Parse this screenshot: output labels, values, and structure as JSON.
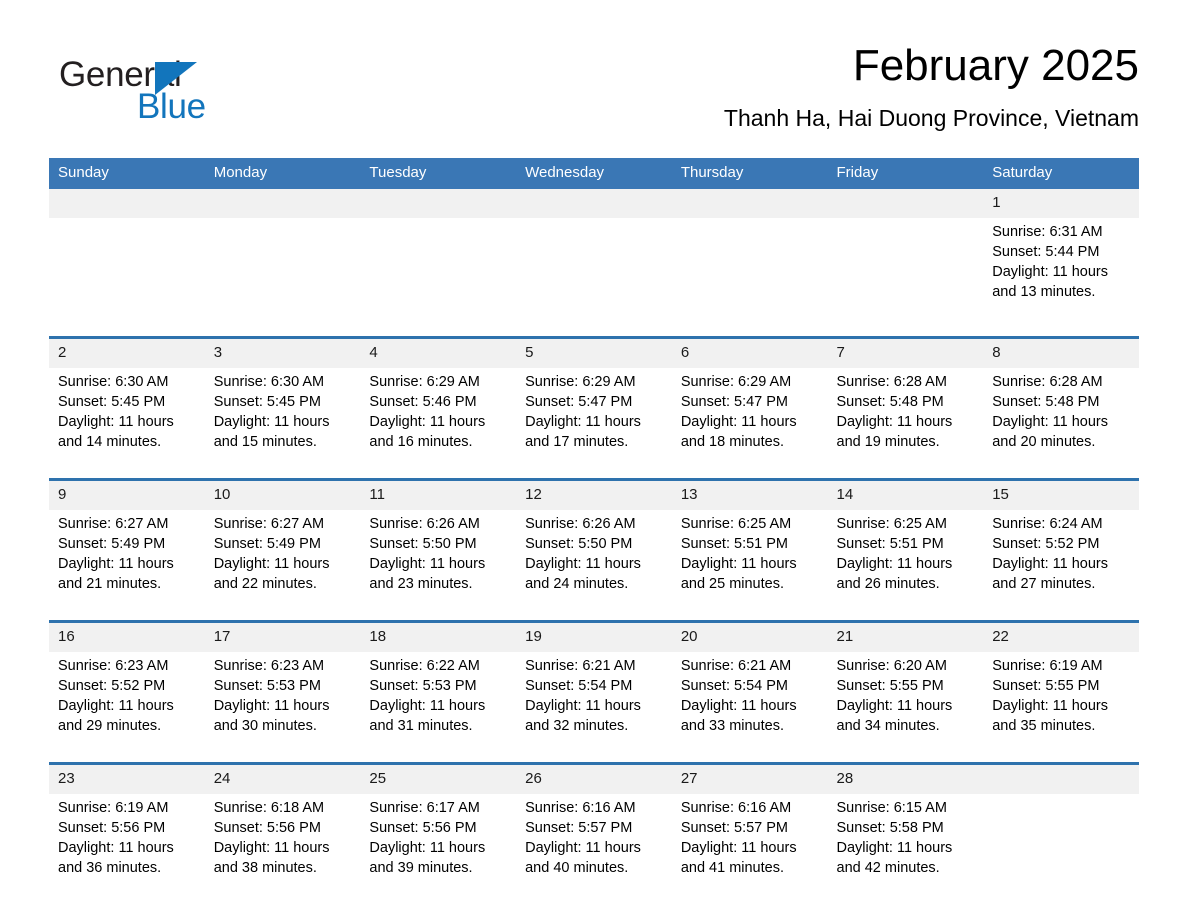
{
  "brand": {
    "name_part1": "General",
    "name_part2": "Blue",
    "accent_color": "#1275bc"
  },
  "header": {
    "month_title": "February 2025",
    "location": "Thanh Ha, Hai Duong Province, Vietnam",
    "header_bg_color": "#3a77b5",
    "week_separator_color": "#2e72ad",
    "daynum_bg_color": "#f1f1f1"
  },
  "weekdays": [
    "Sunday",
    "Monday",
    "Tuesday",
    "Wednesday",
    "Thursday",
    "Friday",
    "Saturday"
  ],
  "labels": {
    "sunrise_prefix": "Sunrise:",
    "sunset_prefix": "Sunset:",
    "daylight_prefix": "Daylight:"
  },
  "weeks": [
    {
      "days": [
        {
          "num": "",
          "sunrise": "",
          "sunset": "",
          "daylight_line1": "",
          "daylight_line2": ""
        },
        {
          "num": "",
          "sunrise": "",
          "sunset": "",
          "daylight_line1": "",
          "daylight_line2": ""
        },
        {
          "num": "",
          "sunrise": "",
          "sunset": "",
          "daylight_line1": "",
          "daylight_line2": ""
        },
        {
          "num": "",
          "sunrise": "",
          "sunset": "",
          "daylight_line1": "",
          "daylight_line2": ""
        },
        {
          "num": "",
          "sunrise": "",
          "sunset": "",
          "daylight_line1": "",
          "daylight_line2": ""
        },
        {
          "num": "",
          "sunrise": "",
          "sunset": "",
          "daylight_line1": "",
          "daylight_line2": ""
        },
        {
          "num": "1",
          "sunrise": "Sunrise: 6:31 AM",
          "sunset": "Sunset: 5:44 PM",
          "daylight_line1": "Daylight: 11 hours",
          "daylight_line2": "and 13 minutes."
        }
      ]
    },
    {
      "days": [
        {
          "num": "2",
          "sunrise": "Sunrise: 6:30 AM",
          "sunset": "Sunset: 5:45 PM",
          "daylight_line1": "Daylight: 11 hours",
          "daylight_line2": "and 14 minutes."
        },
        {
          "num": "3",
          "sunrise": "Sunrise: 6:30 AM",
          "sunset": "Sunset: 5:45 PM",
          "daylight_line1": "Daylight: 11 hours",
          "daylight_line2": "and 15 minutes."
        },
        {
          "num": "4",
          "sunrise": "Sunrise: 6:29 AM",
          "sunset": "Sunset: 5:46 PM",
          "daylight_line1": "Daylight: 11 hours",
          "daylight_line2": "and 16 minutes."
        },
        {
          "num": "5",
          "sunrise": "Sunrise: 6:29 AM",
          "sunset": "Sunset: 5:47 PM",
          "daylight_line1": "Daylight: 11 hours",
          "daylight_line2": "and 17 minutes."
        },
        {
          "num": "6",
          "sunrise": "Sunrise: 6:29 AM",
          "sunset": "Sunset: 5:47 PM",
          "daylight_line1": "Daylight: 11 hours",
          "daylight_line2": "and 18 minutes."
        },
        {
          "num": "7",
          "sunrise": "Sunrise: 6:28 AM",
          "sunset": "Sunset: 5:48 PM",
          "daylight_line1": "Daylight: 11 hours",
          "daylight_line2": "and 19 minutes."
        },
        {
          "num": "8",
          "sunrise": "Sunrise: 6:28 AM",
          "sunset": "Sunset: 5:48 PM",
          "daylight_line1": "Daylight: 11 hours",
          "daylight_line2": "and 20 minutes."
        }
      ]
    },
    {
      "days": [
        {
          "num": "9",
          "sunrise": "Sunrise: 6:27 AM",
          "sunset": "Sunset: 5:49 PM",
          "daylight_line1": "Daylight: 11 hours",
          "daylight_line2": "and 21 minutes."
        },
        {
          "num": "10",
          "sunrise": "Sunrise: 6:27 AM",
          "sunset": "Sunset: 5:49 PM",
          "daylight_line1": "Daylight: 11 hours",
          "daylight_line2": "and 22 minutes."
        },
        {
          "num": "11",
          "sunrise": "Sunrise: 6:26 AM",
          "sunset": "Sunset: 5:50 PM",
          "daylight_line1": "Daylight: 11 hours",
          "daylight_line2": "and 23 minutes."
        },
        {
          "num": "12",
          "sunrise": "Sunrise: 6:26 AM",
          "sunset": "Sunset: 5:50 PM",
          "daylight_line1": "Daylight: 11 hours",
          "daylight_line2": "and 24 minutes."
        },
        {
          "num": "13",
          "sunrise": "Sunrise: 6:25 AM",
          "sunset": "Sunset: 5:51 PM",
          "daylight_line1": "Daylight: 11 hours",
          "daylight_line2": "and 25 minutes."
        },
        {
          "num": "14",
          "sunrise": "Sunrise: 6:25 AM",
          "sunset": "Sunset: 5:51 PM",
          "daylight_line1": "Daylight: 11 hours",
          "daylight_line2": "and 26 minutes."
        },
        {
          "num": "15",
          "sunrise": "Sunrise: 6:24 AM",
          "sunset": "Sunset: 5:52 PM",
          "daylight_line1": "Daylight: 11 hours",
          "daylight_line2": "and 27 minutes."
        }
      ]
    },
    {
      "days": [
        {
          "num": "16",
          "sunrise": "Sunrise: 6:23 AM",
          "sunset": "Sunset: 5:52 PM",
          "daylight_line1": "Daylight: 11 hours",
          "daylight_line2": "and 29 minutes."
        },
        {
          "num": "17",
          "sunrise": "Sunrise: 6:23 AM",
          "sunset": "Sunset: 5:53 PM",
          "daylight_line1": "Daylight: 11 hours",
          "daylight_line2": "and 30 minutes."
        },
        {
          "num": "18",
          "sunrise": "Sunrise: 6:22 AM",
          "sunset": "Sunset: 5:53 PM",
          "daylight_line1": "Daylight: 11 hours",
          "daylight_line2": "and 31 minutes."
        },
        {
          "num": "19",
          "sunrise": "Sunrise: 6:21 AM",
          "sunset": "Sunset: 5:54 PM",
          "daylight_line1": "Daylight: 11 hours",
          "daylight_line2": "and 32 minutes."
        },
        {
          "num": "20",
          "sunrise": "Sunrise: 6:21 AM",
          "sunset": "Sunset: 5:54 PM",
          "daylight_line1": "Daylight: 11 hours",
          "daylight_line2": "and 33 minutes."
        },
        {
          "num": "21",
          "sunrise": "Sunrise: 6:20 AM",
          "sunset": "Sunset: 5:55 PM",
          "daylight_line1": "Daylight: 11 hours",
          "daylight_line2": "and 34 minutes."
        },
        {
          "num": "22",
          "sunrise": "Sunrise: 6:19 AM",
          "sunset": "Sunset: 5:55 PM",
          "daylight_line1": "Daylight: 11 hours",
          "daylight_line2": "and 35 minutes."
        }
      ]
    },
    {
      "days": [
        {
          "num": "23",
          "sunrise": "Sunrise: 6:19 AM",
          "sunset": "Sunset: 5:56 PM",
          "daylight_line1": "Daylight: 11 hours",
          "daylight_line2": "and 36 minutes."
        },
        {
          "num": "24",
          "sunrise": "Sunrise: 6:18 AM",
          "sunset": "Sunset: 5:56 PM",
          "daylight_line1": "Daylight: 11 hours",
          "daylight_line2": "and 38 minutes."
        },
        {
          "num": "25",
          "sunrise": "Sunrise: 6:17 AM",
          "sunset": "Sunset: 5:56 PM",
          "daylight_line1": "Daylight: 11 hours",
          "daylight_line2": "and 39 minutes."
        },
        {
          "num": "26",
          "sunrise": "Sunrise: 6:16 AM",
          "sunset": "Sunset: 5:57 PM",
          "daylight_line1": "Daylight: 11 hours",
          "daylight_line2": "and 40 minutes."
        },
        {
          "num": "27",
          "sunrise": "Sunrise: 6:16 AM",
          "sunset": "Sunset: 5:57 PM",
          "daylight_line1": "Daylight: 11 hours",
          "daylight_line2": "and 41 minutes."
        },
        {
          "num": "28",
          "sunrise": "Sunrise: 6:15 AM",
          "sunset": "Sunset: 5:58 PM",
          "daylight_line1": "Daylight: 11 hours",
          "daylight_line2": "and 42 minutes."
        },
        {
          "num": "",
          "sunrise": "",
          "sunset": "",
          "daylight_line1": "",
          "daylight_line2": ""
        }
      ]
    }
  ]
}
